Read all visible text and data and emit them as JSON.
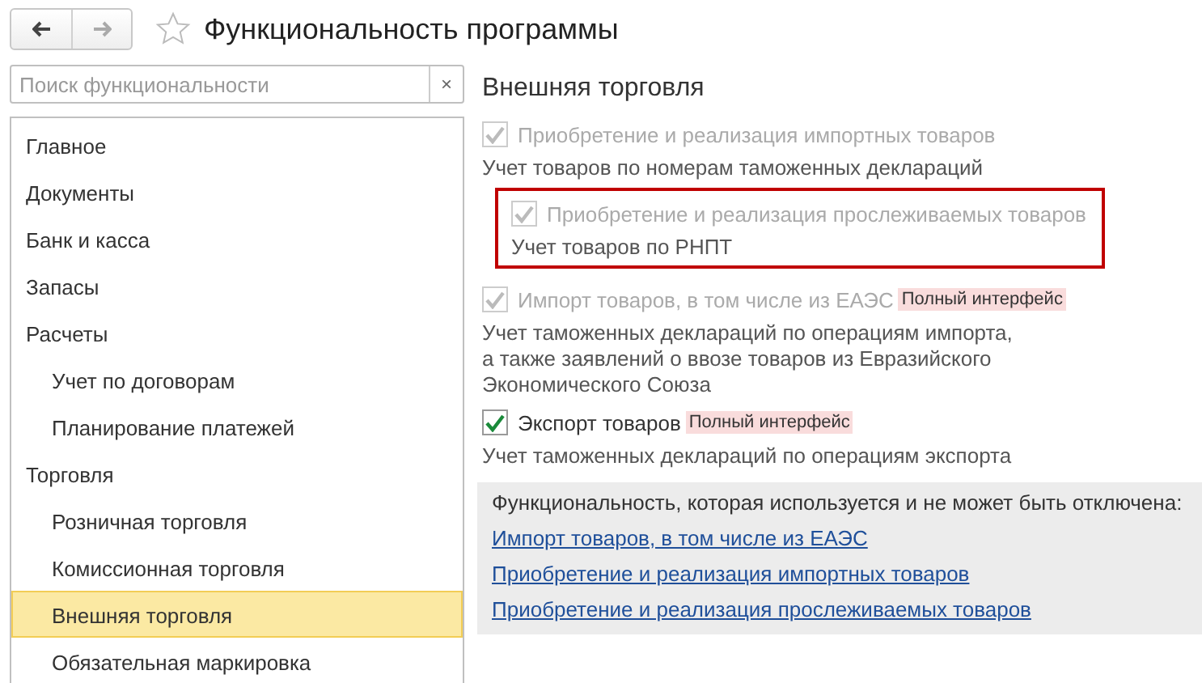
{
  "window": {
    "title": "Функциональность программы"
  },
  "search": {
    "placeholder": "Поиск функциональности",
    "clear": "×"
  },
  "sidebar": {
    "items": [
      {
        "label": "Главное",
        "selected": false
      },
      {
        "label": "Документы",
        "selected": false
      },
      {
        "label": "Банк и касса",
        "selected": false
      },
      {
        "label": "Запасы",
        "selected": false
      },
      {
        "label": "Расчеты",
        "selected": false,
        "children": [
          {
            "label": "Учет по договорам",
            "selected": false
          },
          {
            "label": "Планирование платежей",
            "selected": false
          }
        ]
      },
      {
        "label": "Торговля",
        "selected": false,
        "children": [
          {
            "label": "Розничная торговля",
            "selected": false
          },
          {
            "label": "Комиссионная торговля",
            "selected": false
          },
          {
            "label": "Внешняя торговля",
            "selected": true
          },
          {
            "label": "Обязательная маркировка",
            "selected": false
          }
        ]
      }
    ]
  },
  "section": {
    "title": "Внешняя торговля",
    "options": [
      {
        "label": "Приобретение и реализация импортных товаров",
        "checked": true,
        "disabled": true,
        "highlighted": false,
        "description": "Учет товаров по номерам таможенных деклараций"
      },
      {
        "label": "Приобретение и реализация прослеживаемых товаров",
        "checked": true,
        "disabled": true,
        "highlighted": true,
        "description": "Учет товаров по РНПТ"
      },
      {
        "label": "Импорт товаров, в том числе из ЕАЭС",
        "checked": true,
        "disabled": true,
        "highlighted": false,
        "badge": "Полный интерфейс",
        "description": "Учет таможенных деклараций по операциям импорта,\nа также заявлений о ввозе товаров из Евразийского\nЭкономического Союза"
      },
      {
        "label": "Экспорт товаров",
        "checked": true,
        "disabled": false,
        "highlighted": false,
        "badge": "Полный интерфейс",
        "description": "Учет таможенных деклараций по операциям экспорта"
      }
    ],
    "locked": {
      "text": "Функциональность, которая используется и не может быть отключена:",
      "links": [
        "Импорт товаров, в том числе из ЕАЭС",
        "Приобретение и реализация импортных товаров",
        "Приобретение и реализация прослеживаемых товаров"
      ]
    }
  }
}
